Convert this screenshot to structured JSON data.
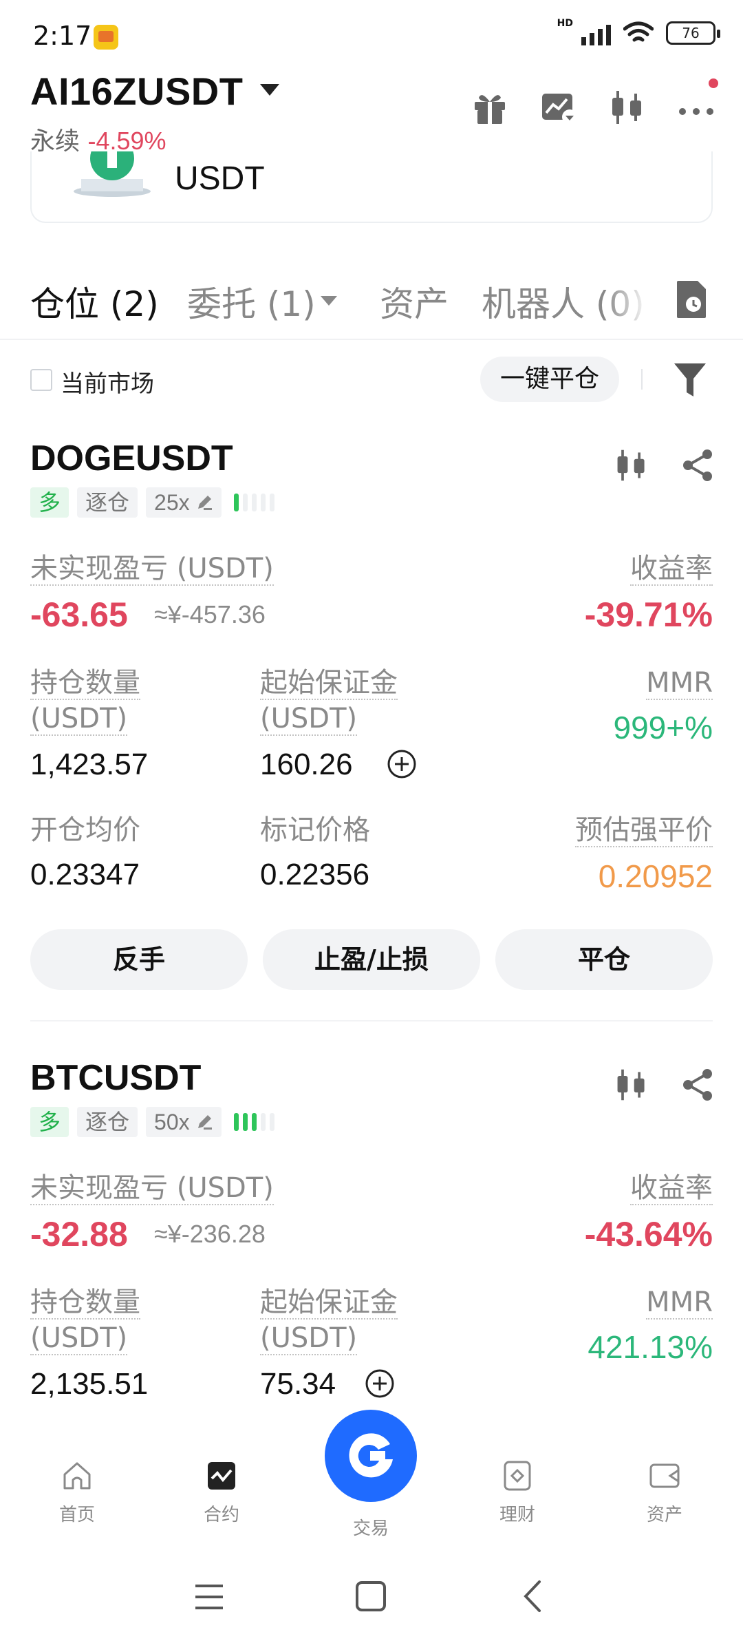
{
  "status_bar": {
    "time": "2:17",
    "battery": "76"
  },
  "header": {
    "pair": "AI16ZUSDT",
    "type_label": "永续",
    "change": "-4.59%"
  },
  "banner": {
    "text": "USDT"
  },
  "tabs": {
    "positions": "仓位 (2)",
    "orders": "委托 (1)",
    "assets": "资产",
    "bots": "机器人 (0)"
  },
  "filter": {
    "current_market_label": "当前市场",
    "close_all_label": "一键平仓"
  },
  "positions": [
    {
      "symbol": "DOGEUSDT",
      "side": "多",
      "margin_mode": "逐仓",
      "leverage": "25x",
      "upnl_label": "未实现盈亏 (USDT)",
      "upnl": "-63.65",
      "upnl_cny": "≈¥-457.36",
      "roe_label": "收益率",
      "roe": "-39.71%",
      "qty_label_1": "持仓数量",
      "qty_label_2": "(USDT)",
      "qty": "1,423.57",
      "margin_label_1": "起始保证金",
      "margin_label_2": "(USDT)",
      "margin": "160.26",
      "mmr_label": "MMR",
      "mmr": "999+%",
      "entry_label": "开仓均价",
      "entry": "0.23347",
      "mark_label": "标记价格",
      "mark": "0.22356",
      "liq_label": "预估强平价",
      "liq": "0.20952",
      "btn_reverse": "反手",
      "btn_tpsl": "止盈/止损",
      "btn_close": "平仓"
    },
    {
      "symbol": "BTCUSDT",
      "side": "多",
      "margin_mode": "逐仓",
      "leverage": "50x",
      "upnl_label": "未实现盈亏 (USDT)",
      "upnl": "-32.88",
      "upnl_cny": "≈¥-236.28",
      "roe_label": "收益率",
      "roe": "-43.64%",
      "qty_label_1": "持仓数量",
      "qty_label_2": "(USDT)",
      "qty": "2,135.51",
      "margin_label_1": "起始保证金",
      "margin_label_2": "(USDT)",
      "margin": "75.34",
      "mmr_label": "MMR",
      "mmr": "421.13%"
    }
  ],
  "bottom_nav": {
    "home": "首页",
    "futures": "合约",
    "trade": "交易",
    "earn": "理财",
    "assets": "资产"
  },
  "colors": {
    "negative": "#e0465e",
    "positive": "#2bb77a",
    "liq": "#f19a4a",
    "brand": "#1f6bff",
    "long_tag": "#21b14b"
  }
}
